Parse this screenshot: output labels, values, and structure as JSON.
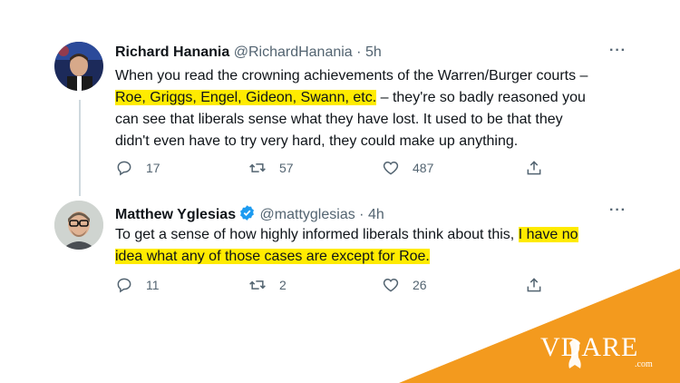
{
  "tweet1": {
    "name": "Richard Hanania",
    "handle": "@RichardHanania",
    "separator": "·",
    "time": "5h",
    "text_before": "When you read the crowning achievements of the Warren/Burger courts –",
    "text_highlight": "Roe, Griggs, Engel, Gideon, Swann, etc.",
    "text_after_1": "– they're so badly reasoned you",
    "text_after_2": "can see that liberals sense what they have lost. It used to be that they",
    "text_after_3": "didn't even have to try very hard, they could make up anything.",
    "replies": "17",
    "retweets": "57",
    "likes": "487",
    "more": "···"
  },
  "tweet2": {
    "name": "Matthew Yglesias",
    "handle": "@mattyglesias",
    "separator": "·",
    "time": "4h",
    "text_before": "To get a sense of how highly informed liberals think about this,",
    "text_highlight_1": "I have no",
    "text_highlight_2": "idea what any of those cases are except for Roe.",
    "replies": "11",
    "retweets": "2",
    "likes": "26",
    "more": "···"
  },
  "watermark": {
    "brand": "VDARE",
    "domain": ".com"
  },
  "colors": {
    "highlight": "#ffeb00",
    "verified": "#1d9bf0",
    "corner_orange": "#f39a1e",
    "muted": "#536471"
  },
  "icons": [
    "reply-icon",
    "retweet-icon",
    "like-icon",
    "share-icon",
    "verified-badge-icon",
    "more-options-icon",
    "eagle-logo-icon"
  ]
}
